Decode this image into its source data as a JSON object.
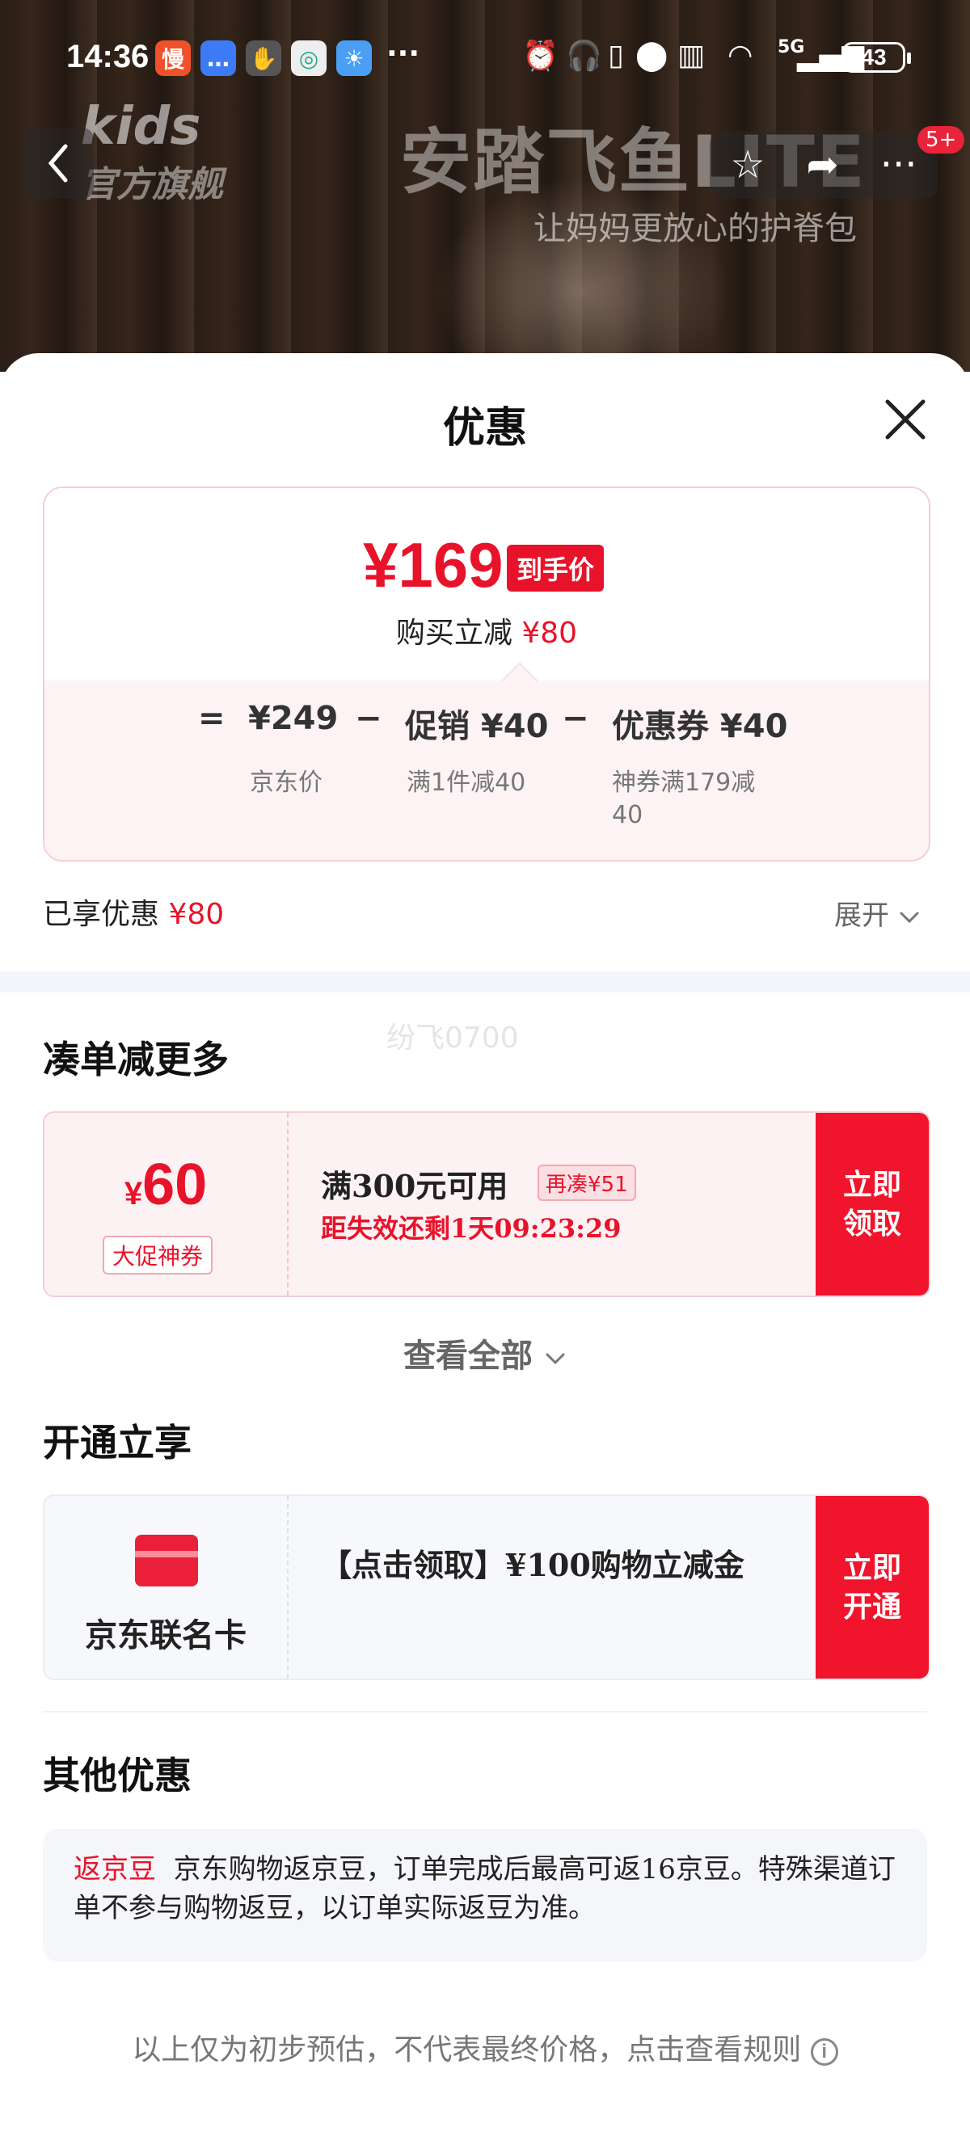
{
  "status_bar": {
    "time": "14:36",
    "app_icons": [
      "慢",
      "chat",
      "hand",
      "mobile",
      "weather"
    ],
    "more": "···",
    "network": "5G",
    "battery": "43"
  },
  "product_header": {
    "brand_kids": "kids",
    "brand_store": "官方旗舰",
    "title": "安踏飞鱼LITE",
    "subtitle": "让妈妈更放心的护脊包",
    "badge": "5+"
  },
  "sheet": {
    "title": "优惠",
    "price": {
      "final_price": "¥169",
      "final_tag": "到手价",
      "reduce_text": "购买立减",
      "reduce_amount": "¥80",
      "eq": "=",
      "minus1": "−",
      "minus2": "−",
      "jd_price": "¥249",
      "jd_price_label": "京东价",
      "promo": "促销 ¥40",
      "promo_label": "满1件减40",
      "coupon": "优惠券 ¥40",
      "coupon_label_1": "神券满179减",
      "coupon_label_2": "40"
    },
    "enjoyed_label": "已享优惠",
    "enjoyed_amount": "¥80",
    "expand_label": "展开",
    "watermark": "纷飞0700",
    "section_combine": {
      "heading": "凑单减更多",
      "coupon_amount": "60",
      "coupon_currency": "¥",
      "coupon_tag": "大促神券",
      "condition": "满300元可用",
      "again_tag": "再凑¥51",
      "expire": "距失效还剩1天09:23:29",
      "btn_line1": "立即",
      "btn_line2": "领取",
      "view_all": "查看全部"
    },
    "section_open": {
      "heading": "开通立享",
      "card_name": "京东联名卡",
      "desc": "【点击领取】¥100购物立减金",
      "btn_line1": "立即",
      "btn_line2": "开通"
    },
    "section_other": {
      "heading": "其他优惠",
      "tag": "返京豆",
      "text": "京东购物返京豆，订单完成后最高可返16京豆。特殊渠道订单不参与购物返豆，以订单实际返豆为准。"
    },
    "footnote": "以上仅为初步预估，不代表最终价格，点击查看规则"
  },
  "colors": {
    "accent": "#e8132a",
    "button": "#f0142c"
  }
}
